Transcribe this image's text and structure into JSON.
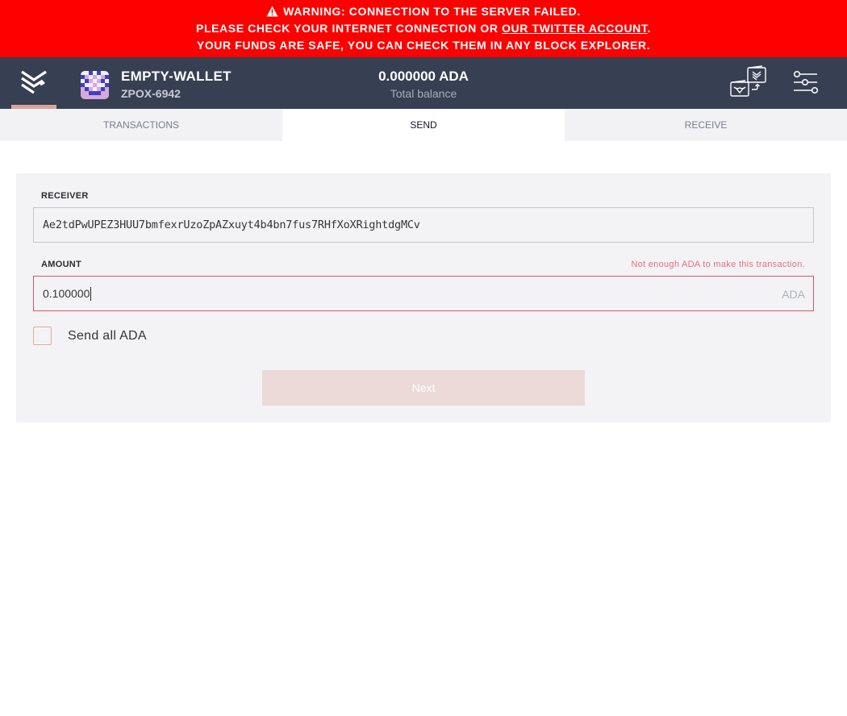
{
  "banner": {
    "line1": "WARNING: CONNECTION TO THE SERVER FAILED.",
    "line2_prefix": "PLEASE CHECK YOUR INTERNET CONNECTION OR ",
    "line2_link": "OUR TWITTER ACCOUNT",
    "line2_suffix": ".",
    "line3": "YOUR FUNDS ARE SAFE, YOU CAN CHECK THEM IN ANY BLOCK EXPLORER.",
    "icon": "warning-icon",
    "color": "#ff0000"
  },
  "header": {
    "logo_icon": "yoroi-logo-icon",
    "wallet_name": "EMPTY-WALLET",
    "wallet_plate": "ZPOX-6942",
    "balance": "0.000000 ADA",
    "balance_label": "Total balance",
    "wallets_icon": "wallets-switch-icon",
    "settings_icon": "settings-sliders-icon",
    "background": "#373f52"
  },
  "tabs": [
    {
      "label": "TRANSACTIONS",
      "active": false
    },
    {
      "label": "SEND",
      "active": true
    },
    {
      "label": "RECEIVE",
      "active": false
    }
  ],
  "send_form": {
    "receiver_label": "RECEIVER",
    "receiver_value": "Ae2tdPwUPEZ3HUU7bmfexrUzoZpAZxuyt4b4bn7fus7RHfXoXRightdgMCv",
    "amount_label": "AMOUNT",
    "amount_error": "Not enough ADA to make this transaction.",
    "amount_value": "0.100000",
    "amount_unit": "ADA",
    "send_all_label": "Send all ADA",
    "send_all_checked": false,
    "next_label": "Next",
    "next_enabled": false,
    "error_color": "#e0536a"
  }
}
